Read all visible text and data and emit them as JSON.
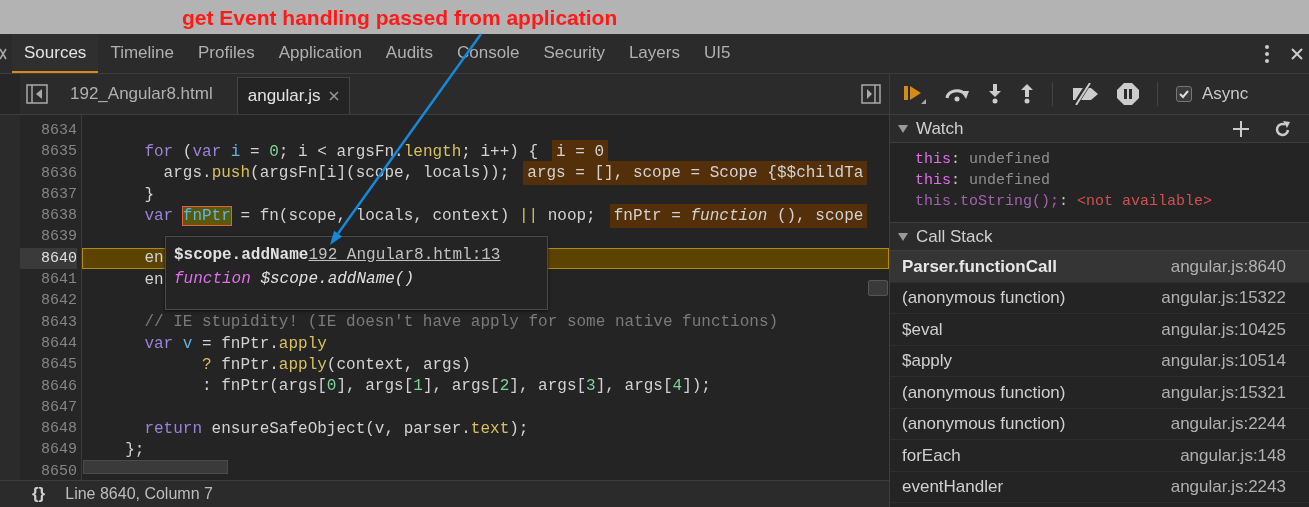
{
  "annotation": {
    "text": "get Event handling passed from application"
  },
  "tabs": [
    {
      "label": "Sources",
      "selected": true
    },
    {
      "label": "Timeline",
      "selected": false
    },
    {
      "label": "Profiles",
      "selected": false
    },
    {
      "label": "Application",
      "selected": false
    },
    {
      "label": "Audits",
      "selected": false
    },
    {
      "label": "Console",
      "selected": false
    },
    {
      "label": "Security",
      "selected": false
    },
    {
      "label": "Layers",
      "selected": false
    },
    {
      "label": "UI5",
      "selected": false
    }
  ],
  "file_tabs": [
    {
      "label": "192_Angular8.html",
      "selected": false
    },
    {
      "label": "angular.js",
      "selected": true
    }
  ],
  "code_lines": [
    {
      "number": "8634",
      "current": false
    },
    {
      "number": "8635",
      "current": false,
      "tokens": [
        {
          "kind": "keyword",
          "text": "    for"
        },
        {
          "kind": "plain",
          "text": " ("
        },
        {
          "kind": "keyword",
          "text": "var"
        },
        {
          "kind": "definition",
          "text": " i"
        },
        {
          "kind": "plain",
          "text": " = "
        },
        {
          "kind": "number",
          "text": "0"
        },
        {
          "kind": "plain",
          "text": "; i < argsFn."
        },
        {
          "kind": "property",
          "text": "length"
        },
        {
          "kind": "plain",
          "text": "; i++) {"
        }
      ],
      "inline_value": "i = 0"
    },
    {
      "number": "8636",
      "current": false,
      "tokens": [
        {
          "kind": "plain",
          "text": "      args."
        },
        {
          "kind": "property",
          "text": "push"
        },
        {
          "kind": "plain",
          "text": "(argsFn[i](scope, locals));"
        }
      ],
      "inline_value": "args = [], scope = Scope {$$childTa"
    },
    {
      "number": "8637",
      "current": false,
      "tokens": [
        {
          "kind": "plain",
          "text": "    }"
        }
      ]
    },
    {
      "number": "8638",
      "current": false,
      "tokens": [
        {
          "kind": "keyword",
          "text": "    var "
        },
        {
          "kind": "hovered",
          "text": "fnPtr"
        },
        {
          "kind": "plain",
          "text": " = fn(scope, locals, context) "
        },
        {
          "kind": "operator",
          "text": "||"
        },
        {
          "kind": "plain",
          "text": " noop;"
        }
      ],
      "inline_value": "fnPtr = *function* (), scope"
    },
    {
      "number": "8639",
      "current": false
    },
    {
      "number": "8640",
      "current": true,
      "tokens": [
        {
          "kind": "plain",
          "text": "    en"
        }
      ]
    },
    {
      "number": "8641",
      "current": false,
      "tokens": [
        {
          "kind": "plain",
          "text": "    en"
        }
      ]
    },
    {
      "number": "8642",
      "current": false
    },
    {
      "number": "8643",
      "current": false,
      "tokens": [
        {
          "kind": "comment",
          "text": "    // IE stupidity! (IE doesn't have apply for some native functions)"
        }
      ]
    },
    {
      "number": "8644",
      "current": false,
      "tokens": [
        {
          "kind": "keyword",
          "text": "    var"
        },
        {
          "kind": "definition",
          "text": " v"
        },
        {
          "kind": "plain",
          "text": " = fnPtr."
        },
        {
          "kind": "property",
          "text": "apply"
        }
      ]
    },
    {
      "number": "8645",
      "current": false,
      "tokens": [
        {
          "kind": "operator",
          "text": "          ?"
        },
        {
          "kind": "plain",
          "text": " fnPtr."
        },
        {
          "kind": "property",
          "text": "apply"
        },
        {
          "kind": "plain",
          "text": "(context, args)"
        }
      ]
    },
    {
      "number": "8646",
      "current": false,
      "tokens": [
        {
          "kind": "plain",
          "text": "          : fnPtr(args["
        },
        {
          "kind": "number",
          "text": "0"
        },
        {
          "kind": "plain",
          "text": "], args["
        },
        {
          "kind": "number",
          "text": "1"
        },
        {
          "kind": "plain",
          "text": "], args["
        },
        {
          "kind": "number",
          "text": "2"
        },
        {
          "kind": "plain",
          "text": "], args["
        },
        {
          "kind": "number",
          "text": "3"
        },
        {
          "kind": "plain",
          "text": "], args["
        },
        {
          "kind": "number",
          "text": "4"
        },
        {
          "kind": "plain",
          "text": "]);"
        }
      ]
    },
    {
      "number": "8647",
      "current": false
    },
    {
      "number": "8648",
      "current": false,
      "tokens": [
        {
          "kind": "keyword",
          "text": "    return"
        },
        {
          "kind": "plain",
          "text": " ensureSafeObject(v, parser."
        },
        {
          "kind": "property",
          "text": "text"
        },
        {
          "kind": "plain",
          "text": ");"
        }
      ]
    },
    {
      "number": "8649",
      "current": false,
      "tokens": [
        {
          "kind": "plain",
          "text": "  };"
        }
      ]
    },
    {
      "number": "8650",
      "current": false
    }
  ],
  "tooltip": {
    "name": "$scope.addName",
    "link": "192_Angular8.html:13",
    "keyword": "function",
    "signature": "$scope.addName()"
  },
  "status_bar": {
    "format_button": "{}",
    "position": "Line 8640, Column 7"
  },
  "async": {
    "label": "Async",
    "checked": true
  },
  "watch": {
    "title": "Watch",
    "expanded": true,
    "items": [
      {
        "name": "this",
        "separator": ":",
        "value": "undefined",
        "available": true
      },
      {
        "name": "this",
        "separator": ":",
        "value": "undefined",
        "available": true
      },
      {
        "name": "this.toString();",
        "separator": ":",
        "value": "<not available>",
        "available": false
      }
    ]
  },
  "call_stack": {
    "title": "Call Stack",
    "expanded": true,
    "frames": [
      {
        "name": "Parser.functionCall",
        "location": "angular.js:8640",
        "selected": true
      },
      {
        "name": "(anonymous function)",
        "location": "angular.js:15322",
        "selected": false
      },
      {
        "name": "$eval",
        "location": "angular.js:10425",
        "selected": false
      },
      {
        "name": "$apply",
        "location": "angular.js:10514",
        "selected": false
      },
      {
        "name": "(anonymous function)",
        "location": "angular.js:15321",
        "selected": false
      },
      {
        "name": "(anonymous function)",
        "location": "angular.js:2244",
        "selected": false
      },
      {
        "name": "forEach",
        "location": "angular.js:148",
        "selected": false
      },
      {
        "name": "eventHandler",
        "location": "angular.js:2243",
        "selected": false
      }
    ]
  }
}
